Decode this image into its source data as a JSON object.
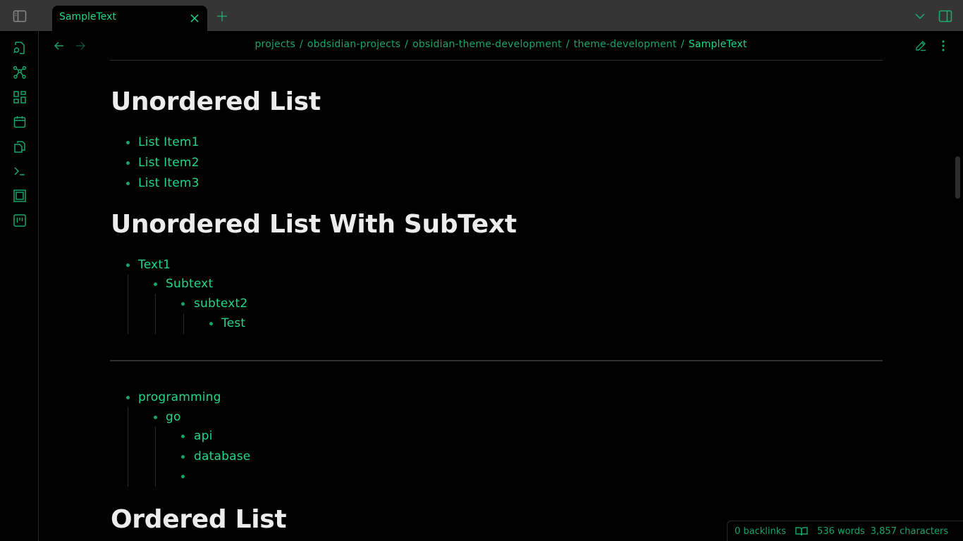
{
  "tab": {
    "title": "SampleText"
  },
  "breadcrumb": {
    "parts": [
      "projects",
      "obdsidian-projects",
      "obsidian-theme-development",
      "theme-development"
    ],
    "separator": "/",
    "current": "SampleText"
  },
  "ribbon_icons": [
    "file-search-icon",
    "graph-icon",
    "grid-icon",
    "calendar-icon",
    "copy-icon",
    "terminal-icon",
    "layers-icon",
    "kanban-icon"
  ],
  "content": {
    "heading1": "Unordered List",
    "list1": [
      "List Item1",
      "List Item2",
      "List Item3"
    ],
    "heading2": "Unordered List With SubText",
    "list2": [
      "Text1",
      "Subtext",
      "subtext2",
      "Test"
    ],
    "list3": [
      "programming",
      "go",
      "api",
      "database",
      ""
    ],
    "heading3": "Ordered List"
  },
  "status": {
    "backlinks": "0 backlinks",
    "words": "536 words",
    "characters": "3,857 characters"
  },
  "colors": {
    "accent": "#1ed889",
    "muted_accent": "#17a56b",
    "heading": "#ececec",
    "titlebar": "#353535"
  }
}
